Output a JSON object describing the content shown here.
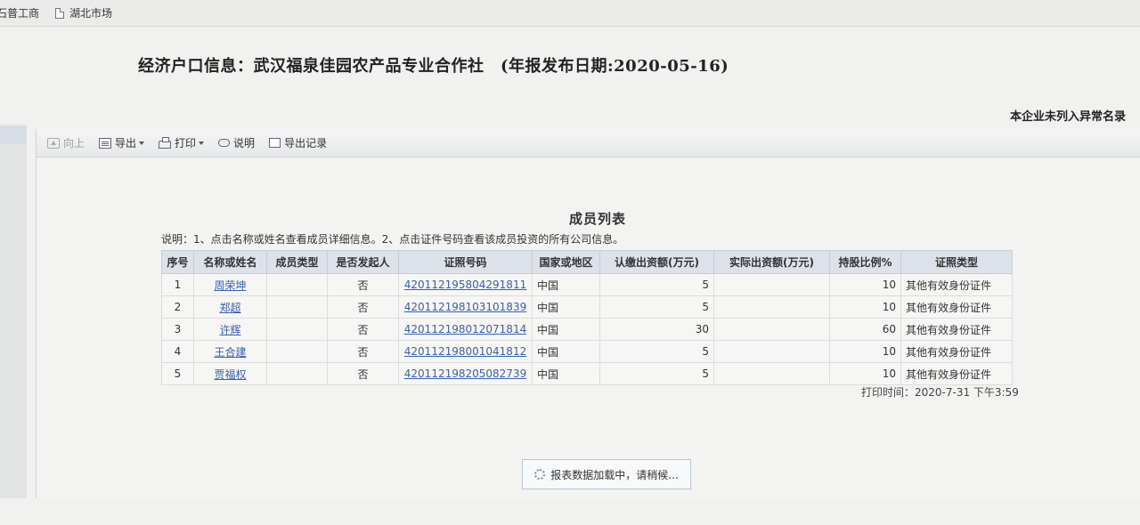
{
  "bookmarks": [
    {
      "label": "石普工商"
    },
    {
      "label": "湖北市场"
    }
  ],
  "page": {
    "heading": "经济户口信息：武汉福泉佳园农产品专业合作社　(年报发布日期:2020-05-16)",
    "notice": "本企业未列入异常名录"
  },
  "toolbar": {
    "up": "向上",
    "export": "导出",
    "print": "打印",
    "explain": "说明",
    "export_log": "导出记录"
  },
  "report": {
    "title": "成员列表",
    "note": "说明：1、点击名称或姓名查看成员详细信息。2、点击证件号码查看该成员投资的所有公司信息。",
    "columns": [
      "序号",
      "名称或姓名",
      "成员类型",
      "是否发起人",
      "证照号码",
      "国家或地区",
      "认缴出资额(万元)",
      "实际出资额(万元)",
      "持股比例%",
      "证照类型"
    ],
    "rows": [
      {
        "no": "1",
        "name": "周荣坤",
        "type": "",
        "initiator": "否",
        "id": "420112195804291811",
        "country": "中国",
        "subscribed": "5",
        "actual": "",
        "ratio": "10",
        "id_type": "其他有效身份证件"
      },
      {
        "no": "2",
        "name": "郑超",
        "type": "",
        "initiator": "否",
        "id": "420112198103101839",
        "country": "中国",
        "subscribed": "5",
        "actual": "",
        "ratio": "10",
        "id_type": "其他有效身份证件"
      },
      {
        "no": "3",
        "name": "许辉",
        "type": "",
        "initiator": "否",
        "id": "420112198012071814",
        "country": "中国",
        "subscribed": "30",
        "actual": "",
        "ratio": "60",
        "id_type": "其他有效身份证件"
      },
      {
        "no": "4",
        "name": "王合建",
        "type": "",
        "initiator": "否",
        "id": "420112198001041812",
        "country": "中国",
        "subscribed": "5",
        "actual": "",
        "ratio": "10",
        "id_type": "其他有效身份证件"
      },
      {
        "no": "5",
        "name": "贾福权",
        "type": "",
        "initiator": "否",
        "id": "420112198205082739",
        "country": "中国",
        "subscribed": "5",
        "actual": "",
        "ratio": "10",
        "id_type": "其他有效身份证件"
      }
    ],
    "print_time": "打印时间：2020-7-31 下午3:59",
    "loading": "报表数据加载中，请稍候..."
  }
}
